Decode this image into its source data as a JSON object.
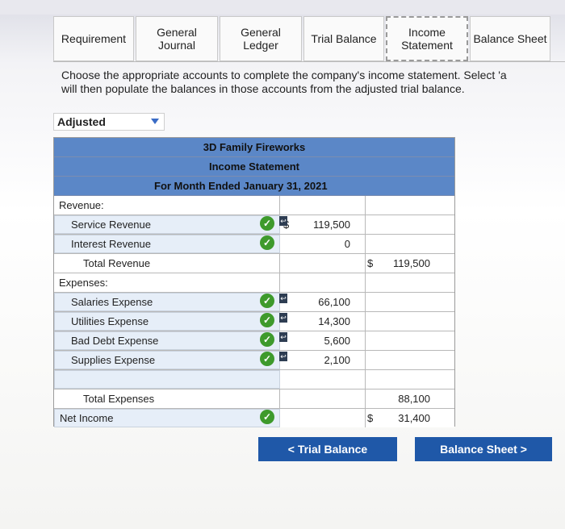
{
  "tabs": [
    {
      "label": "Requirement"
    },
    {
      "label": "General\nJournal"
    },
    {
      "label": "General\nLedger"
    },
    {
      "label": "Trial Balance"
    },
    {
      "label": "Income\nStatement"
    },
    {
      "label": "Balance Sheet"
    }
  ],
  "instructions": {
    "line1": "Choose the appropriate accounts to complete the company's income statement. Select 'a",
    "line2": "will then populate the balances in those accounts from the adjusted trial balance."
  },
  "dropdown": {
    "selected": "Adjusted"
  },
  "statement": {
    "company": "3D Family Fireworks",
    "title": "Income Statement",
    "period": "For Month Ended January 31, 2021",
    "revenue_heading": "Revenue:",
    "revenue_items": [
      {
        "name": "Service Revenue",
        "dollar": "$",
        "amount": "119,500"
      },
      {
        "name": "Interest Revenue",
        "dollar": "",
        "amount": "0"
      }
    ],
    "total_revenue_label": "Total Revenue",
    "total_revenue_dollar": "$",
    "total_revenue": "119,500",
    "expenses_heading": "Expenses:",
    "expense_items": [
      {
        "name": "Salaries Expense",
        "amount": "66,100"
      },
      {
        "name": "Utilities Expense",
        "amount": "14,300"
      },
      {
        "name": "Bad Debt Expense",
        "amount": "5,600"
      },
      {
        "name": "Supplies Expense",
        "amount": "2,100"
      }
    ],
    "total_expenses_label": "Total Expenses",
    "total_expenses": "88,100",
    "net_income_label": "Net Income",
    "net_income_dollar": "$",
    "net_income": "31,400"
  },
  "buttons": {
    "prev": "<  Trial Balance",
    "next": "Balance Sheet  >"
  },
  "colors": {
    "header": "#5b87c7",
    "button": "#1f58a8",
    "check": "#3e9a2c"
  }
}
